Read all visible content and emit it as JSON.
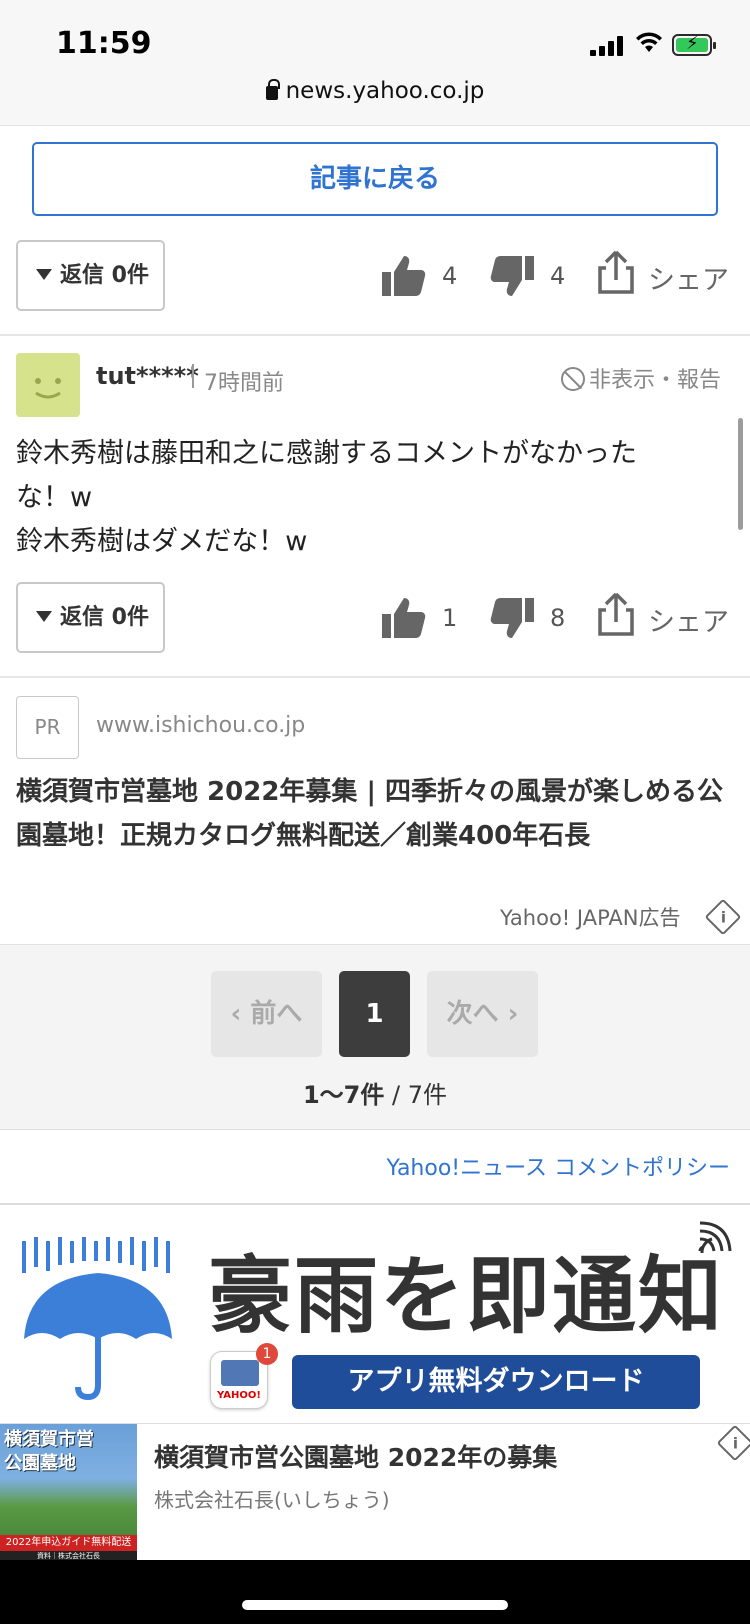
{
  "status_bar": {
    "time": "11:59",
    "url": "news.yahoo.co.jp"
  },
  "back_button": "記事に戻る",
  "comment_prev": {
    "reply_label": "返信 0件",
    "likes": "4",
    "dislikes": "4",
    "share_label": "シェア"
  },
  "comment": {
    "username": "tut*****",
    "time_ago": "7時間前",
    "hide_report": "非表示・報告",
    "lines": [
      "鈴木秀樹は藤田和之に感謝するコメントがなかった",
      "な！w",
      "鈴木秀樹はダメだな！w"
    ],
    "reply_label": "返信 0件",
    "likes": "1",
    "dislikes": "8",
    "share_label": "シェア"
  },
  "pr_ad": {
    "badge": "PR",
    "url": "www.ishichou.co.jp",
    "title": "横須賀市営墓地 2022年募集 | 四季折々の風景が楽しめる公園墓地！正規カタログ無料配送／創業400年石長",
    "credit": "Yahoo! JAPAN広告"
  },
  "pagination": {
    "prev": "前へ",
    "current": "1",
    "next": "次へ",
    "range": "1〜7件",
    "total": " / 7件"
  },
  "policy_link": "Yahoo!ニュース コメントポリシー",
  "banner": {
    "title": "豪雨を即通知",
    "badge_count": "1",
    "app_logo": "YAHOO!",
    "download_label": "アプリ無料ダウンロード"
  },
  "bottom_ad": {
    "thumb_title": "横須賀市営\n公園墓地",
    "thumb_ribbon": "2022年申込ガイド無料配送",
    "thumb_footer": "資料｜株式会社石長",
    "title": "横須賀市営公園墓地 2022年の募集",
    "subtitle": "株式会社石長(いしちょう)"
  },
  "colors": {
    "link_blue": "#2f74d0",
    "page_active": "#3d3d3d",
    "banner_button": "#1f4d9a",
    "umbrella_blue": "#3b7fd8"
  }
}
